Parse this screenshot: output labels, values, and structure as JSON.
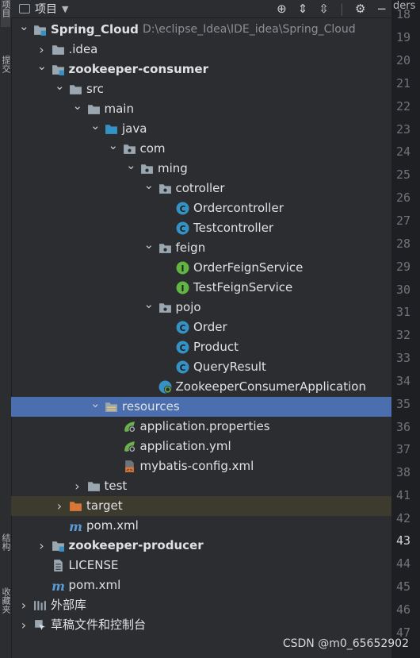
{
  "window": {
    "panel_title": "项目",
    "tab_fragment": "ders"
  },
  "side_strip": {
    "top_labels": [
      "项目",
      "提交"
    ],
    "bottom_labels": [
      "结构",
      "收藏夹"
    ]
  },
  "tree": [
    {
      "label": "Spring_Cloud",
      "path": "D:\\eclipse_Idea\\IDE_idea\\Spring_Cloud",
      "icon": "module-folder-icon",
      "level": 0,
      "arrow": "down",
      "bold": true
    },
    {
      "label": ".idea",
      "icon": "folder-icon",
      "level": 1,
      "arrow": "right"
    },
    {
      "label": "zookeeper-consumer",
      "icon": "module-folder-icon",
      "level": 1,
      "arrow": "down",
      "bold": true
    },
    {
      "label": "src",
      "icon": "folder-icon",
      "level": 2,
      "arrow": "down"
    },
    {
      "label": "main",
      "icon": "folder-icon",
      "level": 3,
      "arrow": "down"
    },
    {
      "label": "java",
      "icon": "source-folder-icon",
      "level": 4,
      "arrow": "down"
    },
    {
      "label": "com",
      "icon": "package-icon",
      "level": 5,
      "arrow": "down"
    },
    {
      "label": "ming",
      "icon": "package-icon",
      "level": 6,
      "arrow": "down"
    },
    {
      "label": "cotroller",
      "icon": "package-icon",
      "level": 7,
      "arrow": "down"
    },
    {
      "label": "Ordercontroller",
      "icon": "class-icon",
      "level": 8
    },
    {
      "label": "Testcontroller",
      "icon": "class-icon",
      "level": 8
    },
    {
      "label": "feign",
      "icon": "package-icon",
      "level": 7,
      "arrow": "down"
    },
    {
      "label": "OrderFeignService",
      "icon": "interface-icon",
      "level": 8
    },
    {
      "label": "TestFeignService",
      "icon": "interface-icon",
      "level": 8
    },
    {
      "label": "pojo",
      "icon": "package-icon",
      "level": 7,
      "arrow": "down"
    },
    {
      "label": "Order",
      "icon": "class-icon",
      "level": 8
    },
    {
      "label": "Product",
      "icon": "class-icon",
      "level": 8
    },
    {
      "label": "QueryResult",
      "icon": "class-icon",
      "level": 8
    },
    {
      "label": "ZookeeperConsumerApplication",
      "icon": "spring-boot-app-icon",
      "level": 7
    },
    {
      "label": "resources",
      "icon": "resources-folder-icon",
      "level": 4,
      "arrow": "down",
      "selected": true
    },
    {
      "label": "application.properties",
      "icon": "spring-config-icon",
      "level": 5
    },
    {
      "label": "application.yml",
      "icon": "spring-config-icon",
      "level": 5
    },
    {
      "label": "mybatis-config.xml",
      "icon": "xml-file-icon",
      "level": 5
    },
    {
      "label": "test",
      "icon": "folder-icon",
      "level": 3,
      "arrow": "right"
    },
    {
      "label": "target",
      "icon": "excluded-folder-icon",
      "level": 2,
      "arrow": "right",
      "highlight": true
    },
    {
      "label": "pom.xml",
      "icon": "maven-icon",
      "level": 2
    },
    {
      "label": "zookeeper-producer",
      "icon": "module-folder-icon",
      "level": 1,
      "arrow": "right",
      "bold": true
    },
    {
      "label": "LICENSE",
      "icon": "text-file-icon",
      "level": 1
    },
    {
      "label": "pom.xml",
      "icon": "maven-icon",
      "level": 1
    },
    {
      "label": "外部库",
      "icon": "library-icon",
      "level": 0,
      "arrow": "right"
    },
    {
      "label": "草稿文件和控制台",
      "icon": "scratch-icon",
      "level": 0,
      "arrow": "right"
    }
  ],
  "gutter": {
    "lines": [
      "18",
      "19",
      "20",
      "21",
      "22",
      "23",
      "24",
      "25",
      "26",
      "27",
      "28",
      "29",
      "30",
      "31",
      "32",
      "33",
      "34",
      "35",
      "36",
      "37",
      "38",
      "41",
      "42",
      "43",
      "44",
      "45",
      "46",
      "47"
    ],
    "current": "43"
  },
  "watermark": "CSDN @m0_65652902",
  "colors": {
    "selection": "#4b6eaf",
    "highlight": "#3d3b2e",
    "class": "#3592c4",
    "interface": "#62b543",
    "spring": "#6ab04c",
    "folder": "#9aa7b0",
    "excluded": "#d9773a"
  }
}
